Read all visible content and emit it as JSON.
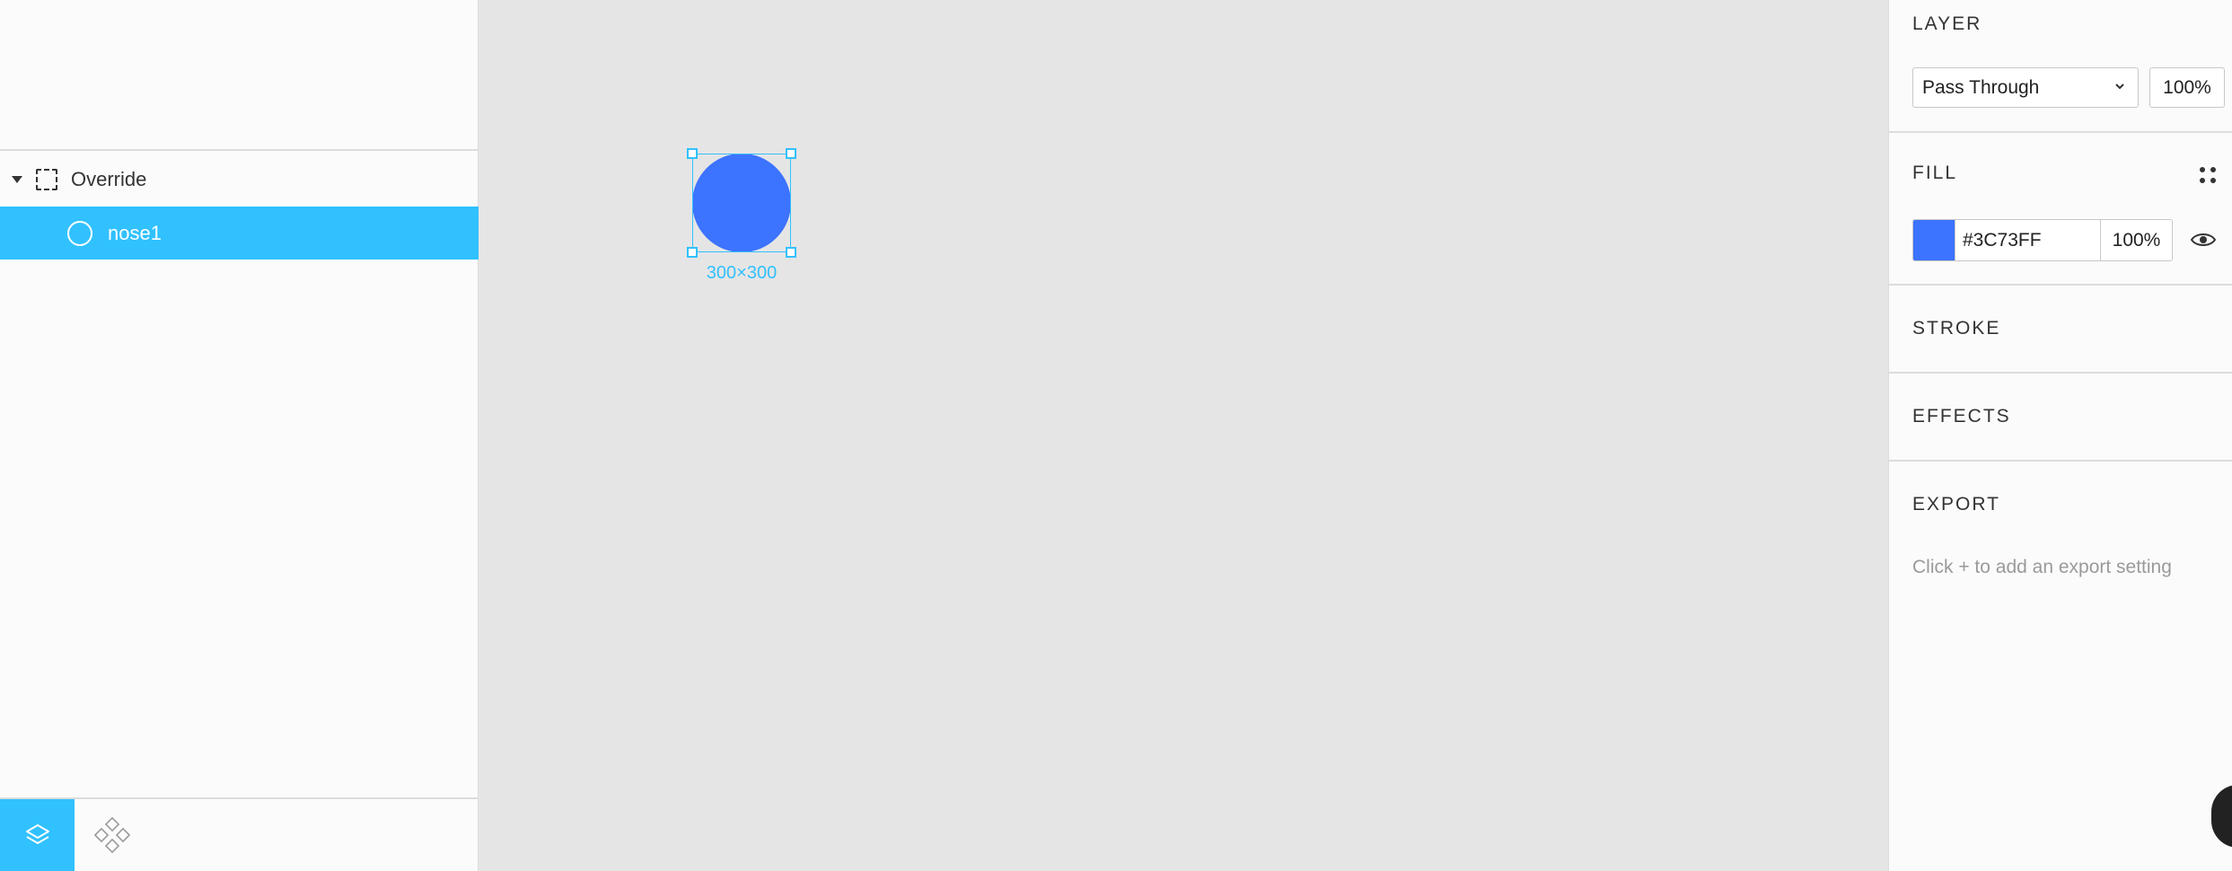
{
  "layers": {
    "items": [
      {
        "label": "Override",
        "icon": "frame-icon"
      },
      {
        "label": "nose1",
        "icon": "ellipse-icon"
      }
    ]
  },
  "bottom_tabs": [
    "layers-tab-icon",
    "components-tab-icon"
  ],
  "canvas": {
    "shape_color": "#3C73FF",
    "size_label": "300×300"
  },
  "panel": {
    "layer": {
      "title": "LAYER",
      "blend_mode": "Pass Through",
      "opacity": "100%"
    },
    "fill": {
      "title": "FILL",
      "hex": "#3C73FF",
      "opacity": "100%"
    },
    "stroke": {
      "title": "STROKE"
    },
    "effects": {
      "title": "EFFECTS"
    },
    "export": {
      "title": "EXPORT",
      "hint": "Click + to add an export setting"
    }
  },
  "colors": {
    "accent": "#31C1FF",
    "fill": "#3C73FF"
  }
}
